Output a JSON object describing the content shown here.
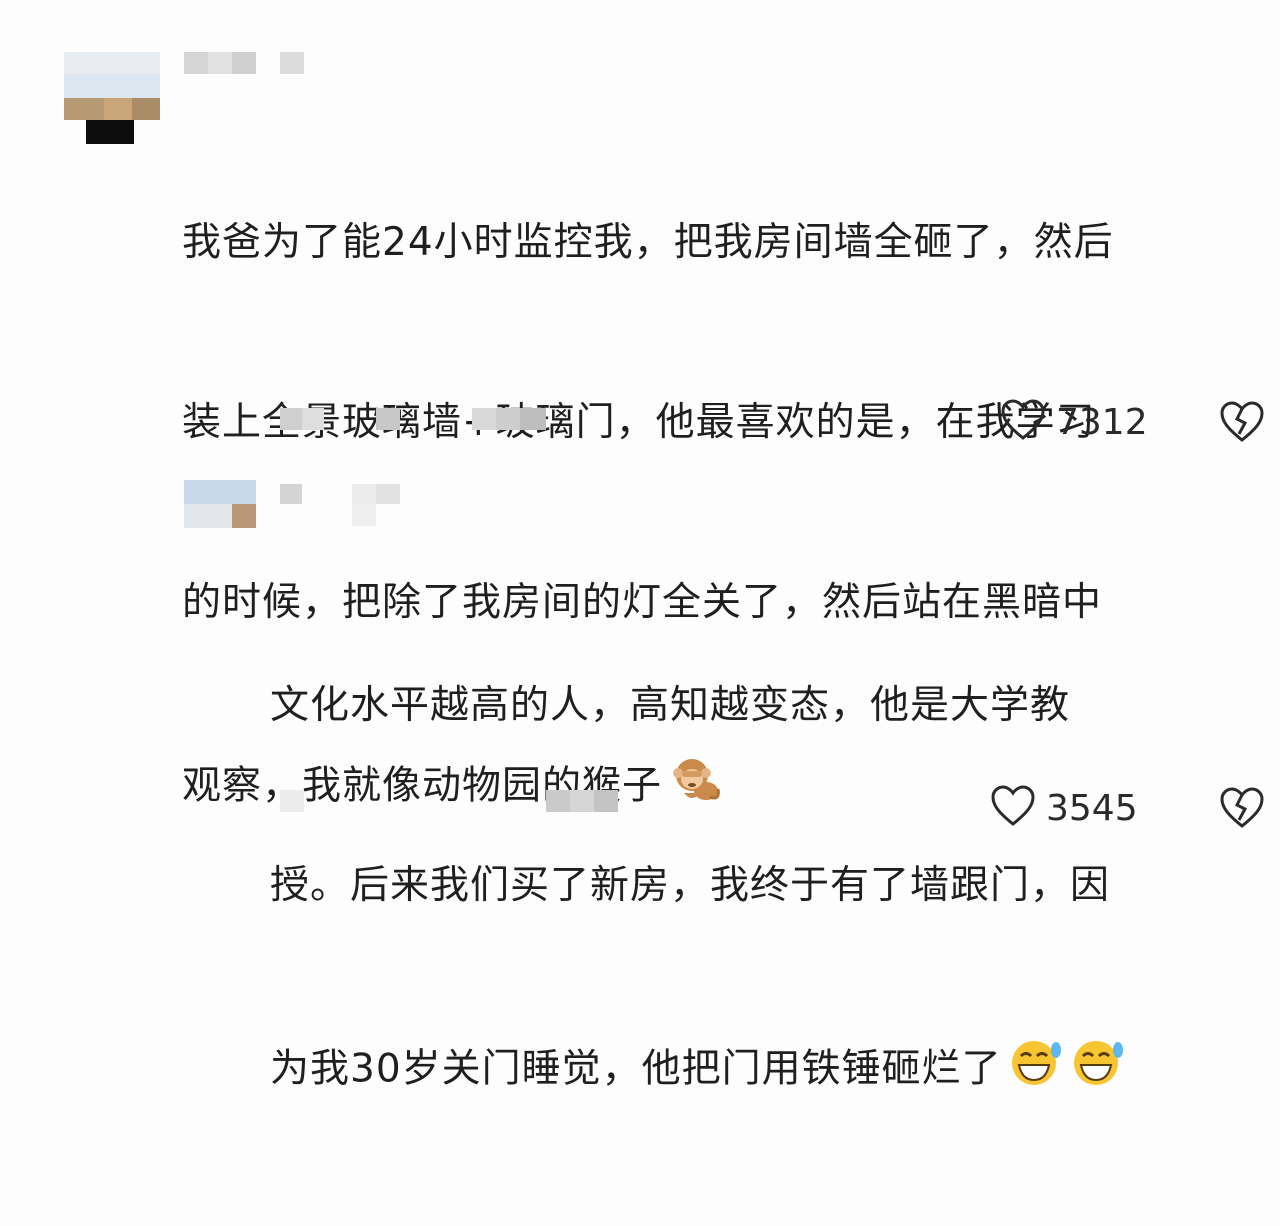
{
  "comments": [
    {
      "lines": [
        "我爸为了能24小时监控我，把我房间墙全砸了，然后",
        "装上全景玻璃墙+玻璃门，他最喜欢的是，在我学习",
        "的时候，把除了我房间的灯全关了，然后站在黑暗中",
        "观察，我就像动物园的猴子"
      ],
      "emojis": [
        "monkey-emoji"
      ],
      "like_count": "7312",
      "icons": {
        "like": "heart-outline-icon",
        "dislike": "broken-heart-icon"
      }
    },
    {
      "lines": [
        "文化水平越高的人，高知越变态，他是大学教",
        "授。后来我们买了新房，我终于有了墙跟门，因",
        "为我30岁关门睡觉，他把门用铁锤砸烂了"
      ],
      "emojis": [
        "laughing-tears-emoji",
        "laughing-tears-emoji"
      ],
      "like_count": "3545",
      "icons": {
        "like": "heart-outline-icon",
        "dislike": "broken-heart-icon"
      }
    }
  ]
}
